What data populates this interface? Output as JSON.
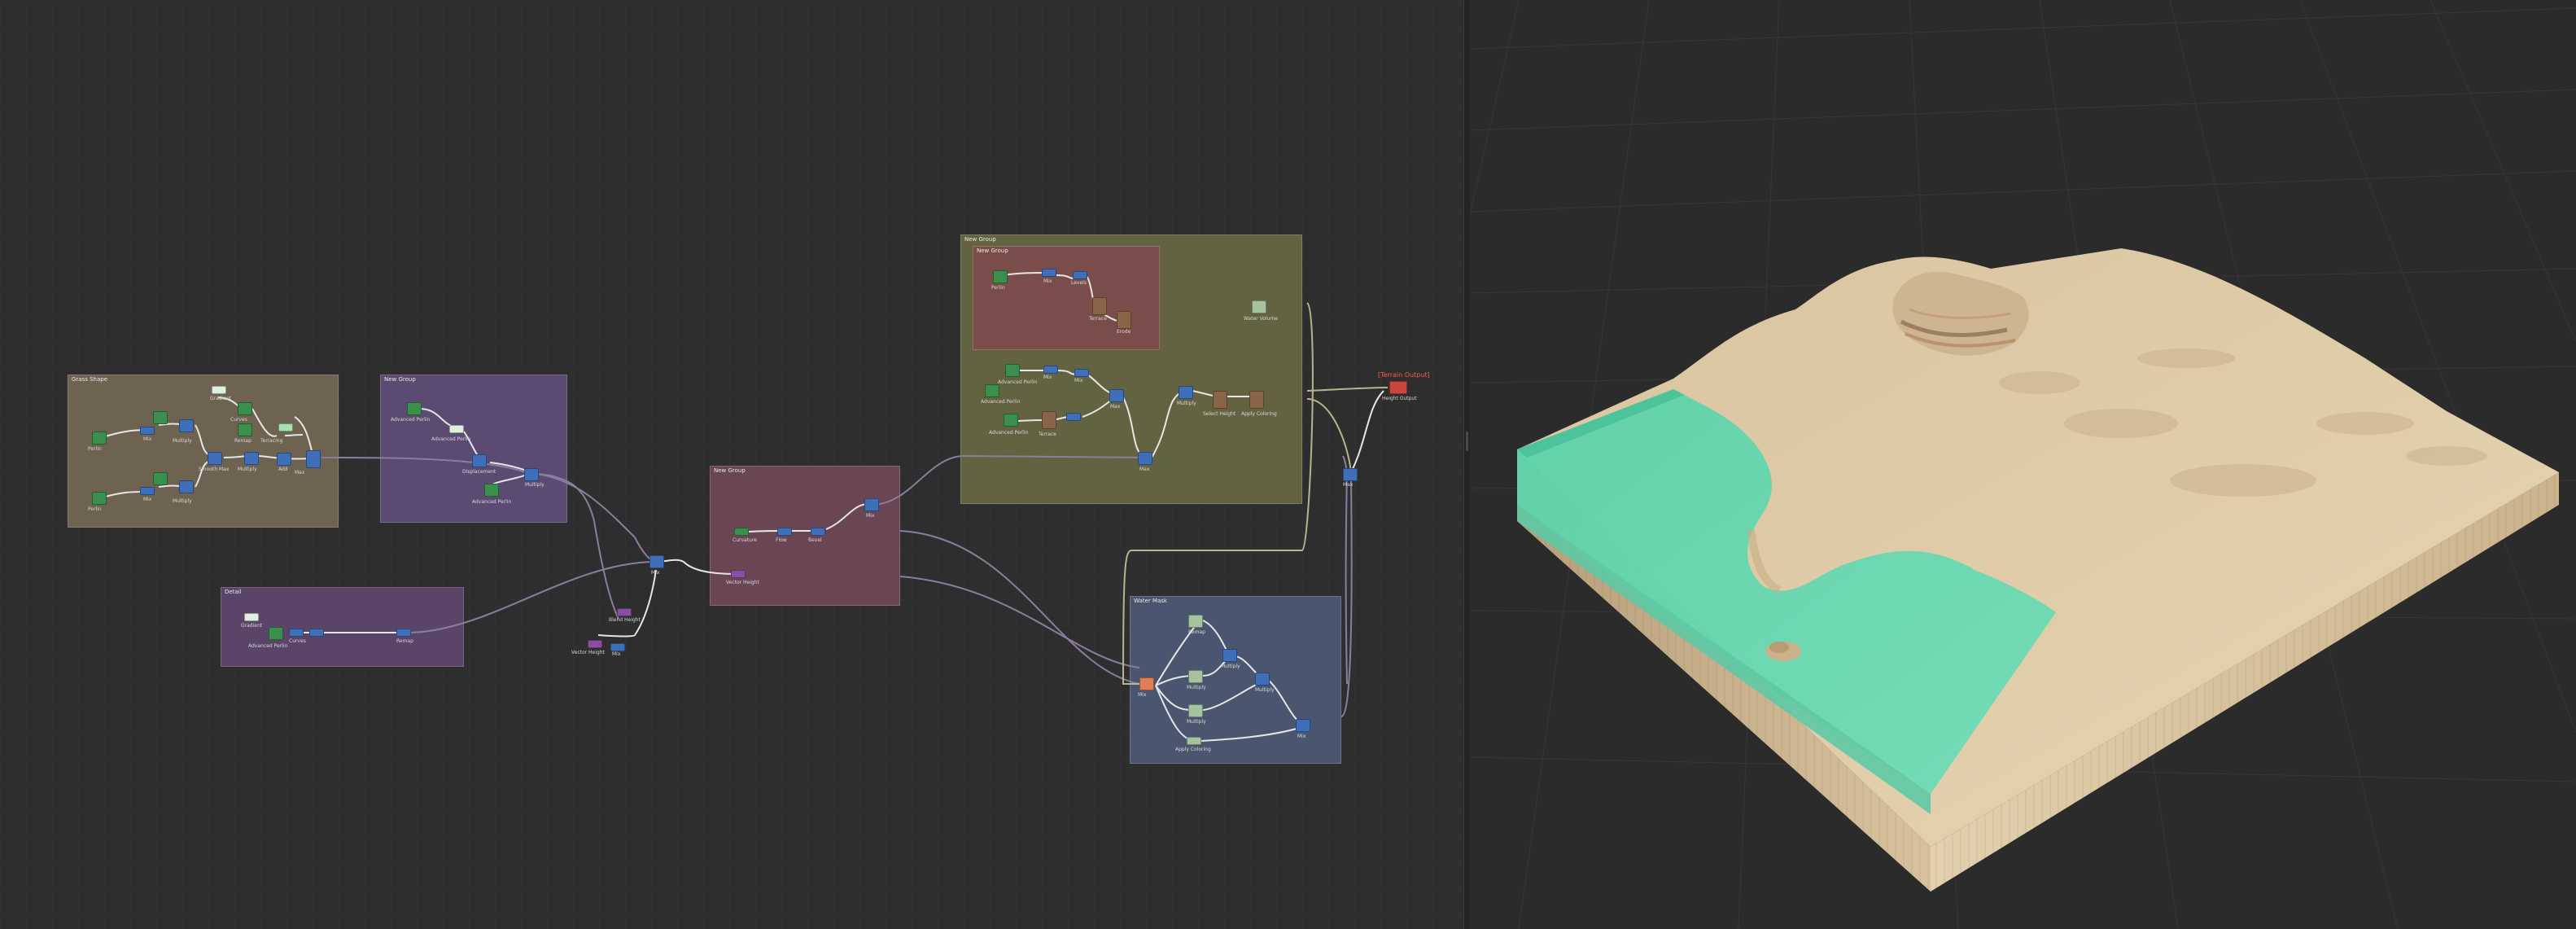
{
  "editor": {
    "groups": {
      "brown": "Grass Shape",
      "purple": "New Group",
      "dark_purple": "Detail",
      "pink": "New Group",
      "olive": "New Group",
      "olive_inner": "New Group",
      "blue": "Water Mask"
    },
    "labels": {
      "l1": "Perlin",
      "l2": "Mix",
      "l3": "Multiply",
      "l4": "Gradient",
      "l5": "Perlin",
      "l6": "Mix",
      "l7": "Multiply",
      "l8": "Smooth Max",
      "l9": "Remap",
      "l10": "Curves",
      "l11": "Terracing",
      "l12": "Advanced Perlin",
      "l13": "Advanced Perlin",
      "l14": "Displacement",
      "l15": "Multiply",
      "l16": "Advanced Perlin",
      "l17": "Gradient",
      "l18": "Advanced Perlin",
      "l19": "Curves",
      "l20": "Remap",
      "l21": "Blend Height",
      "l22": "Levels",
      "l23": "Multiply",
      "l24": "Mix",
      "l25": "Vector Height",
      "l26": "Vector Height",
      "l27": "Add",
      "l28": "Bevel",
      "l29": "Curvature",
      "l30": "Flow",
      "l31": "Bevel",
      "l32": "Curves",
      "l33": "Perlin",
      "l34": "Mix",
      "l35": "Levels",
      "l36": "Terrace",
      "l37": "Max",
      "l38": "Advanced Perlin",
      "l39": "Mix",
      "l40": "Mix",
      "l41": "Erode",
      "l42": "Select Height",
      "l43": "Apply Coloring",
      "l44": "Multiply",
      "l45": "Multiply",
      "l46": "Water Volume",
      "l47": "Remap",
      "l48": "Multiply",
      "l49": "Multiply",
      "l50": "Multiply",
      "l51": "Mix",
      "l52": "Height Output",
      "l53": "Max"
    },
    "warning": "[Terrain Output]",
    "colors": {
      "generator": "#3a8f4c",
      "filter": "#3f6fb8",
      "mask": "#a6c3a0",
      "erosion": "#8a6448",
      "output": "#c9463e",
      "orange": "#e07d54",
      "purple_node": "#8a4fa0"
    }
  },
  "viewport": {
    "terrain_colors": {
      "sand": "#d9c3a0",
      "water": "#5fd6ae",
      "cliff": "#cdb48e"
    }
  }
}
